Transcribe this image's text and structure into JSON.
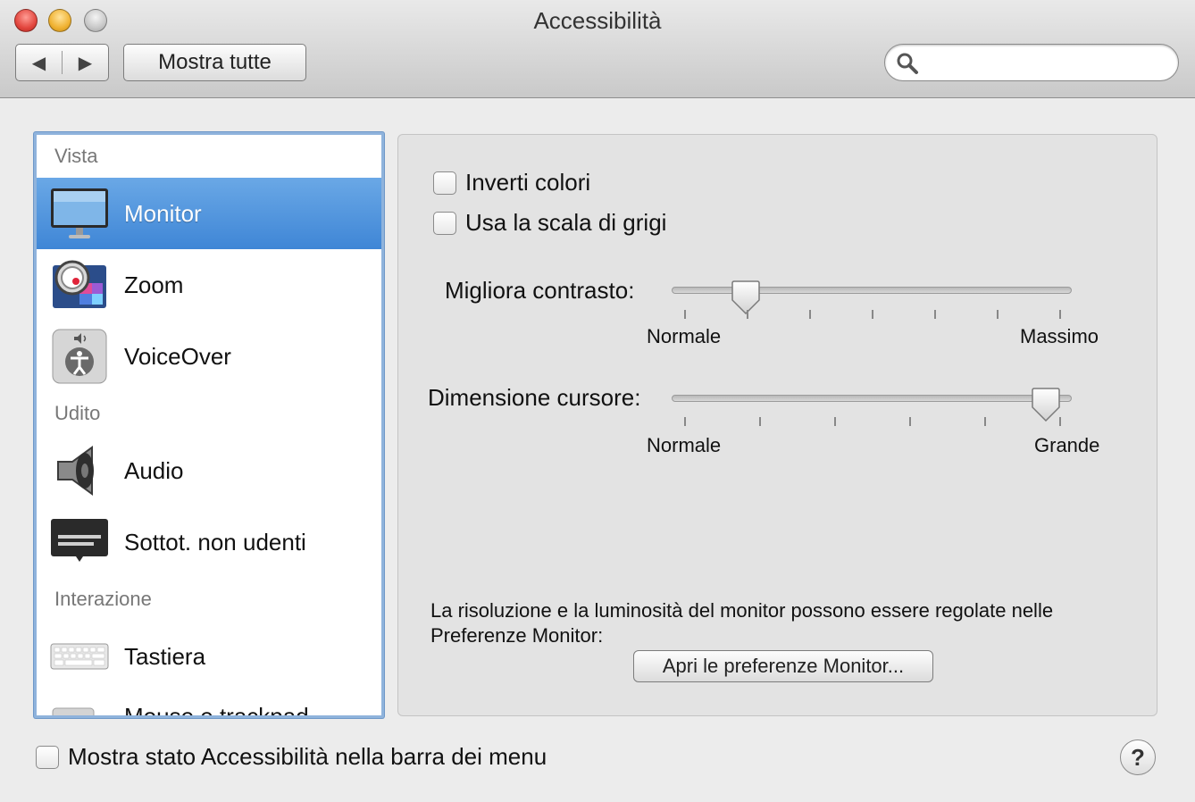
{
  "window": {
    "title": "Accessibilità"
  },
  "toolbar": {
    "back_glyph": "◀",
    "forward_glyph": "▶",
    "show_all_label": "Mostra tutte",
    "search_placeholder": ""
  },
  "sidebar": {
    "sections": [
      {
        "header": "Vista",
        "items": [
          {
            "label": "Monitor",
            "icon": "monitor-icon",
            "selected": true
          },
          {
            "label": "Zoom",
            "icon": "zoom-icon",
            "selected": false
          },
          {
            "label": "VoiceOver",
            "icon": "voiceover-icon",
            "selected": false
          }
        ]
      },
      {
        "header": "Udito",
        "items": [
          {
            "label": "Audio",
            "icon": "speaker-icon",
            "selected": false
          },
          {
            "label": "Sottot. non udenti",
            "icon": "captions-icon",
            "selected": false
          }
        ]
      },
      {
        "header": "Interazione",
        "items": [
          {
            "label": "Tastiera",
            "icon": "keyboard-icon",
            "selected": false
          },
          {
            "label": "Mouse e trackpad",
            "icon": "mouse-icon",
            "selected": false
          }
        ]
      }
    ]
  },
  "panel": {
    "invert_colors_label": "Inverti colori",
    "invert_colors_checked": false,
    "grayscale_label": "Usa la scala di grigi",
    "grayscale_checked": false,
    "contrast": {
      "label": "Migliora contrasto:",
      "min_label": "Normale",
      "max_label": "Massimo",
      "value_fraction": 0.16,
      "ticks": 7
    },
    "cursor": {
      "label": "Dimensione cursore:",
      "min_label": "Normale",
      "max_label": "Grande",
      "value_fraction": 0.97,
      "ticks": 6
    },
    "info_text": "La risoluzione e la luminosità del monitor possono essere regolate nelle Preferenze Monitor:",
    "open_prefs_label": "Apri le preferenze Monitor..."
  },
  "footer": {
    "show_status_label": "Mostra stato Accessibilità nella barra dei menu",
    "show_status_checked": false,
    "help_label": "?"
  },
  "colors": {
    "selection": "#3f86d6",
    "focus_ring": "#8fb3dc",
    "background": "#ececec"
  }
}
